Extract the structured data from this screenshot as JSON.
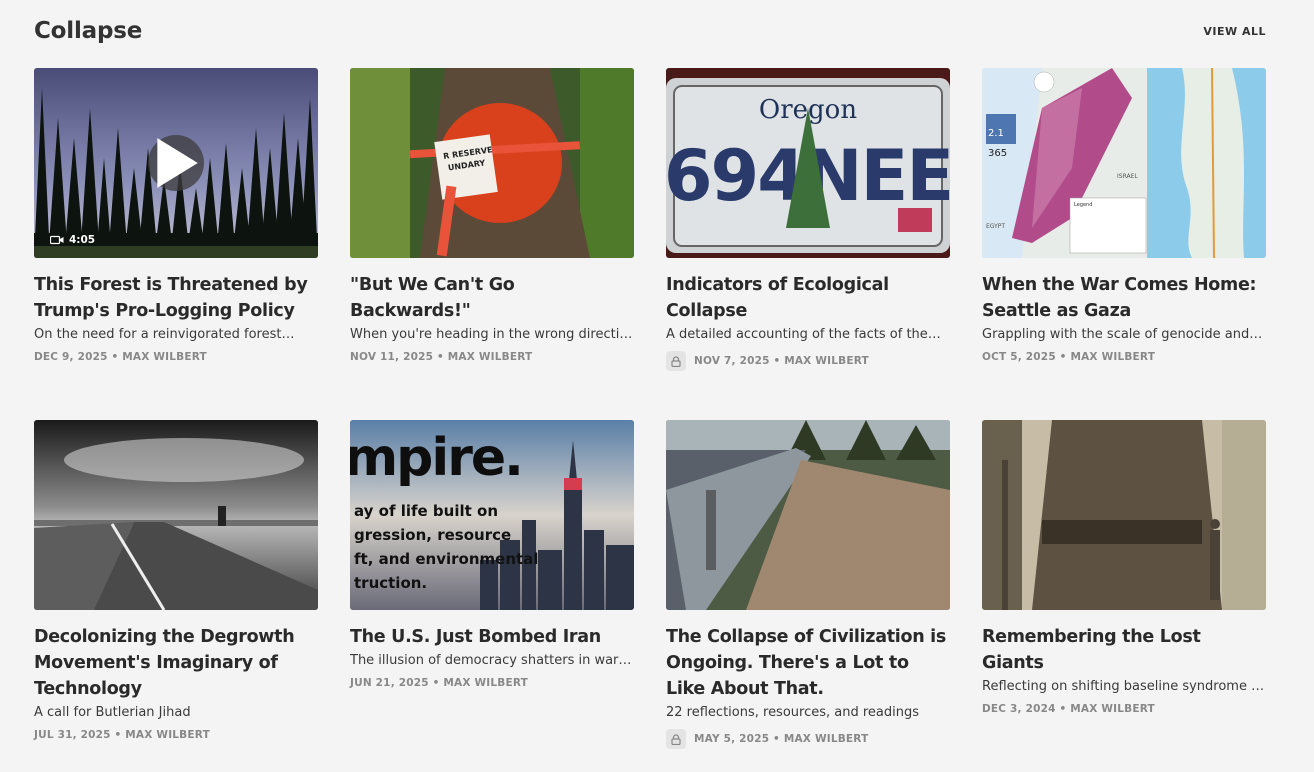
{
  "section": {
    "title": "Collapse",
    "view_all": "VIEW ALL"
  },
  "posts": [
    {
      "title": "This Forest is Threatened by Trump's Pro-Logging Policy",
      "subtitle": "On the need for a reinvigorated forest…",
      "meta": "DEC 9, 2025 • MAX WILBERT",
      "video_duration": "4:05"
    },
    {
      "title": "\"But We Can't Go Backwards!\"",
      "subtitle": "When you're heading in the wrong direction…",
      "meta": "NOV 11, 2025 • MAX WILBERT",
      "image_text": "R RESERVE UNDARY"
    },
    {
      "title": "Indicators of Ecological Collapse",
      "subtitle": "A detailed accounting of the facts of the…",
      "meta": "NOV 7, 2025 • MAX WILBERT",
      "locked": true,
      "image_text": {
        "state": "Oregon",
        "plate": "694NEE"
      }
    },
    {
      "title": "When the War Comes Home: Seattle as Gaza",
      "subtitle": "Grappling with the scale of genocide and th…",
      "meta": "OCT 5, 2025 • MAX WILBERT",
      "image_text": {
        "label_israel": "ISRAEL",
        "label_egypt": "EGYPT",
        "legend": "Legend",
        "stat_value": "2.1",
        "stat_value_2": "365"
      }
    },
    {
      "title": "Decolonizing the Degrowth Movement's Imaginary of Technology",
      "subtitle": "A call for Butlerian Jihad",
      "meta": "JUL 31, 2025 • MAX WILBERT"
    },
    {
      "title": "The U.S. Just Bombed Iran",
      "subtitle": "The illusion of democracy shatters in wartime",
      "meta": "JUN 21, 2025 • MAX WILBERT",
      "image_text": {
        "headline": "mpire.",
        "line1": "ay of life built on",
        "line2": "gression, resource",
        "line3": "ft, and environmental",
        "line4": "truction."
      }
    },
    {
      "title": "The Collapse of Civilization is Ongoing. There's a Lot to Like About That.",
      "subtitle": "22 reflections, resources, and readings",
      "meta": "MAY 5, 2025 • MAX WILBERT",
      "locked": true
    },
    {
      "title": "Remembering the Lost Giants",
      "subtitle": "Reflecting on shifting baseline syndrome an…",
      "meta": "DEC 3, 2024 • MAX WILBERT"
    }
  ]
}
